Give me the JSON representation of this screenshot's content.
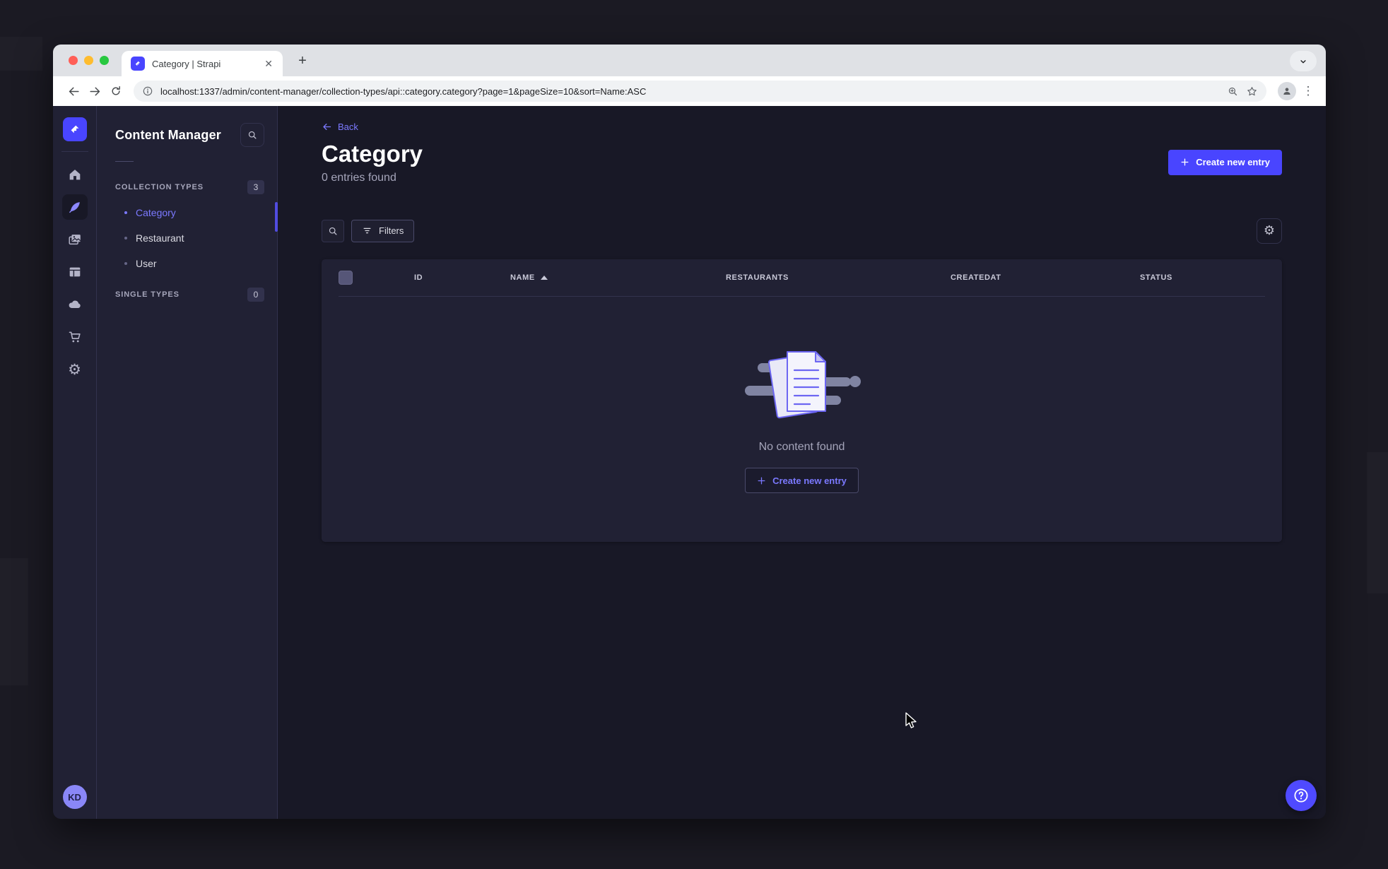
{
  "browser": {
    "tab": {
      "title": "Category | Strapi",
      "close_glyph": "✕",
      "favicon": "strapi-logo-icon"
    },
    "new_tab_label": "+",
    "url": "localhost:1337/admin/content-manager/collection-types/api::category.category?page=1&pageSize=10&sort=Name:ASC",
    "toolbar_icons": [
      "back-icon",
      "forward-icon",
      "reload-icon",
      "info-icon",
      "zoom-icon",
      "bookmark-star-icon",
      "profile-icon",
      "overflow-menu-icon"
    ],
    "menu_dots_glyph": "⋮"
  },
  "app": {
    "nav_rail": {
      "icons": [
        "home-icon",
        "content-manager-icon",
        "media-library-icon",
        "content-type-builder-icon",
        "cloud-icon",
        "marketplace-icon",
        "settings-icon"
      ],
      "active_icon": "content-manager-icon",
      "gear_glyph": "⚙",
      "avatar_initials": "KD"
    },
    "panel": {
      "title": "Content Manager",
      "sections": [
        {
          "label": "COLLECTION TYPES",
          "badge": "3",
          "items": [
            {
              "label": "Category",
              "active": true
            },
            {
              "label": "Restaurant",
              "active": false
            },
            {
              "label": "User",
              "active": false
            }
          ]
        },
        {
          "label": "SINGLE TYPES",
          "badge": "0",
          "items": []
        }
      ]
    },
    "main": {
      "back_label": "Back",
      "title": "Category",
      "entries_count": "0 entries found",
      "create_button": "Create new entry",
      "filters_button": "Filters",
      "table": {
        "columns": [
          "ID",
          "NAME",
          "RESTAURANTS",
          "CREATEDAT",
          "STATUS"
        ],
        "sorted_by": "NAME",
        "sort_dir": "asc",
        "rows": []
      },
      "empty": {
        "message": "No content found",
        "cta": "Create new entry"
      }
    },
    "colors": {
      "primary": "#4945ff",
      "link": "#7b79ff",
      "page_bg": "#181826",
      "surface": "#212134",
      "border": "#32324d",
      "muted_text": "#a5a5ba"
    }
  }
}
